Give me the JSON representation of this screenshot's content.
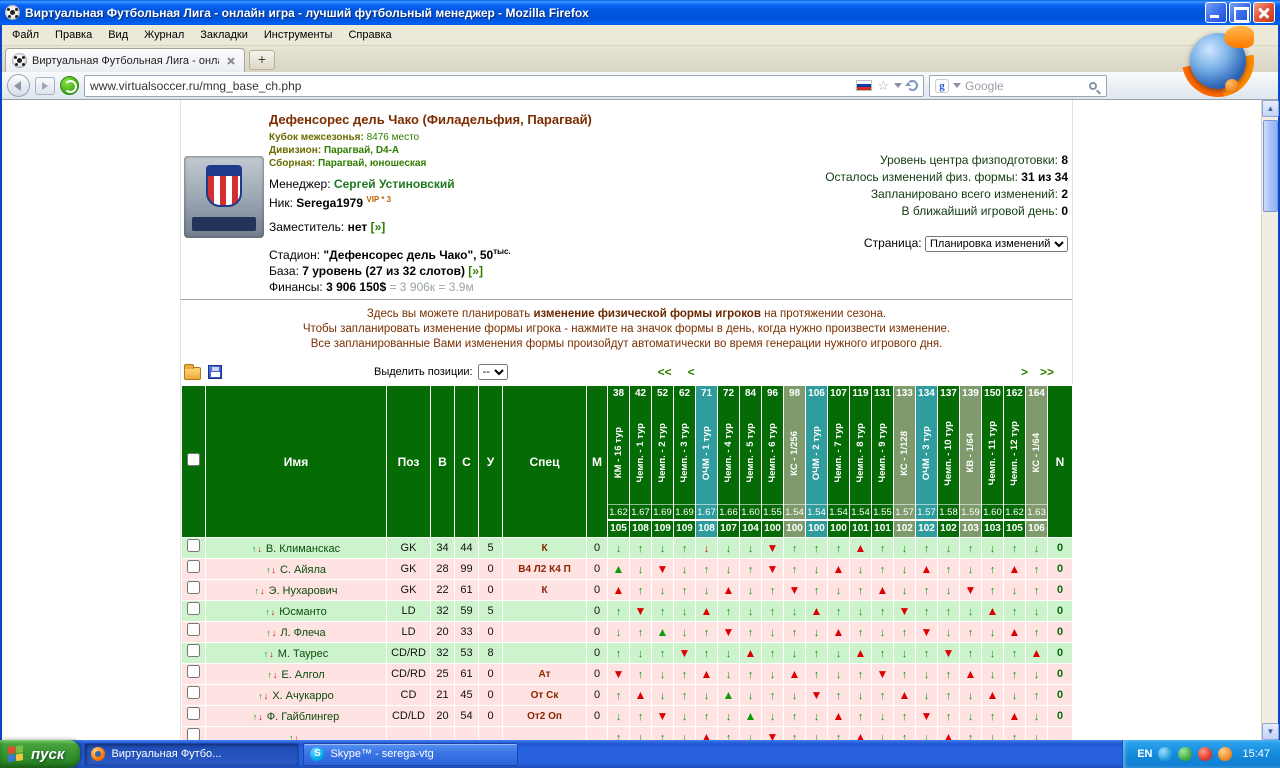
{
  "window": {
    "title": "Виртуальная Футбольная Лига - онлайн игра - лучший футбольный менеджер - Mozilla Firefox"
  },
  "menu": {
    "items": [
      "Файл",
      "Правка",
      "Вид",
      "Журнал",
      "Закладки",
      "Инструменты",
      "Справка"
    ]
  },
  "tabs": {
    "active": "Виртуальная Футбольная Лига - онлай...",
    "new_tab": "+"
  },
  "navbar": {
    "url": "www.virtualsoccer.ru/mng_base_ch.php",
    "search_placeholder": "Google"
  },
  "team": {
    "title": "Дефенсорес дель Чако (Филадельфия, Парагвай)",
    "cup_label": "Кубок межсезонья:",
    "cup_value": "8476 место",
    "division_label": "Дивизион:",
    "division_value": "Парагвай, D4-A",
    "national_label": "Сборная:",
    "national_value": "Парагвай, юношеская",
    "manager_label": "Менеджер:",
    "manager_value": "Сергей Устиновский",
    "nick_label": "Ник:",
    "nick_value": "Serega1979",
    "nick_vip": "VIP * 3",
    "deputy_label": "Заместитель:",
    "deputy_value": "нет",
    "deputy_link": "[»]",
    "stadium_label": "Стадион:",
    "stadium_value": "\"Дефенсорес дель Чако\", 50",
    "stadium_sup": "тыс.",
    "base_label": "База:",
    "base_value": "7 уровень (27 из 32 слотов)",
    "base_link": "[»]",
    "finances_label": "Финансы:",
    "finances_value": "3 906 150$",
    "finances_extra": "= 3 906к = 3.9м"
  },
  "info": {
    "lines": [
      {
        "label": "Уровень центра физподготовки:",
        "value": "8"
      },
      {
        "label": "Осталось изменений физ. формы:",
        "value": "31 из 34"
      },
      {
        "label": "Запланировано всего изменений:",
        "value": "2"
      },
      {
        "label": "В ближайший игровой день:",
        "value": "0"
      }
    ],
    "page_label": "Страница:",
    "page_value": "Планировка изменений"
  },
  "instructions": {
    "line1_pre": "Здесь вы можете планировать ",
    "line1_bold": "изменение физической формы игроков",
    "line1_post": " на протяжении сезона.",
    "line2": "Чтобы запланировать изменение формы игрока - нажмите на значок формы в день, когда нужно произвести изменение.",
    "line3": "Все запланированные Вами изменения формы произойдут автоматически во время генерации нужного игрового дня."
  },
  "toolbar": {
    "select_label": "Выделить позиции:",
    "select_value": "--",
    "pag_first": "<<",
    "pag_prev": "<",
    "pag_next": ">",
    "pag_last": ">>"
  },
  "table": {
    "header_left": [
      "Имя",
      "Поз",
      "В",
      "С",
      "У",
      "Спец",
      "М"
    ],
    "header_right": "N",
    "tours": [
      {
        "day": "38",
        "label": "КМ - 16 тур",
        "type": "km",
        "coef": "1.62",
        "wear": "105"
      },
      {
        "day": "42",
        "label": "Чемп. - 1 тур",
        "type": "ch",
        "coef": "1.67",
        "wear": "108"
      },
      {
        "day": "52",
        "label": "Чемп. - 2 тур",
        "type": "ch",
        "coef": "1.69",
        "wear": "109"
      },
      {
        "day": "62",
        "label": "Чемп. - 3 тур",
        "type": "ch",
        "coef": "1.69",
        "wear": "109"
      },
      {
        "day": "71",
        "label": "ОЧМ - 1 тур",
        "type": "ochm",
        "coef": "1.67",
        "wear": "108"
      },
      {
        "day": "72",
        "label": "Чемп. - 4 тур",
        "type": "ch",
        "coef": "1.66",
        "wear": "107"
      },
      {
        "day": "84",
        "label": "Чемп. - 5 тур",
        "type": "ch",
        "coef": "1.60",
        "wear": "104"
      },
      {
        "day": "96",
        "label": "Чемп. - 6 тур",
        "type": "ch",
        "coef": "1.55",
        "wear": "100"
      },
      {
        "day": "98",
        "label": "КС - 1/256",
        "type": "ks",
        "coef": "1.54",
        "wear": "100"
      },
      {
        "day": "106",
        "label": "ОЧМ - 2 тур",
        "type": "ochm",
        "coef": "1.54",
        "wear": "100"
      },
      {
        "day": "107",
        "label": "Чемп. - 7 тур",
        "type": "ch",
        "coef": "1.54",
        "wear": "100"
      },
      {
        "day": "119",
        "label": "Чемп. - 8 тур",
        "type": "ch",
        "coef": "1.54",
        "wear": "101"
      },
      {
        "day": "131",
        "label": "Чемп. - 9 тур",
        "type": "ch",
        "coef": "1.55",
        "wear": "101"
      },
      {
        "day": "133",
        "label": "КС - 1/128",
        "type": "ks",
        "coef": "1.57",
        "wear": "102"
      },
      {
        "day": "134",
        "label": "ОЧМ - 3 тур",
        "type": "ochm",
        "coef": "1.57",
        "wear": "102"
      },
      {
        "day": "137",
        "label": "Чемп. - 10 тур",
        "type": "ch",
        "coef": "1.58",
        "wear": "102"
      },
      {
        "day": "139",
        "label": "КВ - 1/64",
        "type": "kv",
        "coef": "1.59",
        "wear": "103"
      },
      {
        "day": "150",
        "label": "Чемп. - 11 тур",
        "type": "ch",
        "coef": "1.60",
        "wear": "103"
      },
      {
        "day": "162",
        "label": "Чемп. - 12 тур",
        "type": "ch",
        "coef": "1.62",
        "wear": "105"
      },
      {
        "day": "164",
        "label": "КС - 1/64",
        "type": "ks",
        "coef": "1.63",
        "wear": "106"
      }
    ],
    "players": [
      {
        "name": "В. Климанскас",
        "pos": "GK",
        "age": "34",
        "strength": "44",
        "fatigue": "5",
        "spec": "К",
        "morale": "0",
        "n": "0",
        "row": "g",
        "arrows": [
          "gd",
          "gu",
          "gd",
          "gu",
          "rd",
          "gd",
          "gd",
          "RD",
          "gu",
          "gu",
          "gu",
          "RU",
          "gu",
          "gd",
          "gu",
          "gd",
          "gu",
          "gd",
          "gu",
          "gd"
        ]
      },
      {
        "name": "С. Айяла",
        "pos": "GK",
        "age": "28",
        "strength": "99",
        "fatigue": "0",
        "spec": "В4 Л2 К4 П",
        "morale": "0",
        "n": "0",
        "row": "p",
        "arrows": [
          "GU",
          "gd",
          "RD",
          "gd",
          "gu",
          "gd",
          "gu",
          "RD",
          "gu",
          "gd",
          "RU",
          "gd",
          "gu",
          "gd",
          "RU",
          "gu",
          "gd",
          "gu",
          "RU",
          "gu"
        ]
      },
      {
        "name": "Э. Нухарович",
        "pos": "GK",
        "age": "22",
        "strength": "61",
        "fatigue": "0",
        "spec": "К",
        "morale": "0",
        "n": "0",
        "row": "p",
        "arrows": [
          "RU",
          "gu",
          "gd",
          "gu",
          "gd",
          "RU",
          "gd",
          "gu",
          "RD",
          "gu",
          "gd",
          "gu",
          "RU",
          "gd",
          "gu",
          "gd",
          "RD",
          "gu",
          "gd",
          "gu"
        ]
      },
      {
        "name": "Юсманто",
        "pos": "LD",
        "age": "32",
        "strength": "59",
        "fatigue": "5",
        "spec": "",
        "morale": "0",
        "n": "0",
        "row": "g",
        "arrows": [
          "gu",
          "RD",
          "gu",
          "gd",
          "RU",
          "gu",
          "gd",
          "gu",
          "gd",
          "RU",
          "gu",
          "gd",
          "gu",
          "RD",
          "gu",
          "gu",
          "gd",
          "RU",
          "gu",
          "gd"
        ]
      },
      {
        "name": "Л. Флеча",
        "pos": "LD",
        "age": "20",
        "strength": "33",
        "fatigue": "0",
        "spec": "",
        "morale": "0",
        "n": "0",
        "row": "p",
        "arrows": [
          "gd",
          "gu",
          "GU",
          "gd",
          "gu",
          "RD",
          "gu",
          "gd",
          "gu",
          "gd",
          "RU",
          "gu",
          "gd",
          "gu",
          "RD",
          "gd",
          "gu",
          "gd",
          "RU",
          "gu"
        ]
      },
      {
        "name": "М. Таурес",
        "pos": "CD/RD",
        "age": "32",
        "strength": "53",
        "fatigue": "8",
        "spec": "",
        "morale": "0",
        "n": "0",
        "row": "g",
        "arrows": [
          "gu",
          "gd",
          "gu",
          "RD",
          "gu",
          "gd",
          "RU",
          "gu",
          "gd",
          "gu",
          "gd",
          "RU",
          "gu",
          "gd",
          "gu",
          "RD",
          "gu",
          "gd",
          "gu",
          "RU"
        ]
      },
      {
        "name": "Е. Алгол",
        "pos": "CD/RD",
        "age": "25",
        "strength": "61",
        "fatigue": "0",
        "spec": "Ат",
        "morale": "0",
        "n": "0",
        "row": "p",
        "arrows": [
          "RD",
          "gu",
          "gd",
          "gu",
          "RU",
          "gd",
          "gu",
          "gd",
          "RU",
          "gu",
          "gd",
          "gu",
          "RD",
          "gu",
          "gd",
          "gu",
          "RU",
          "gd",
          "gu",
          "gd"
        ]
      },
      {
        "name": "Х. Ачукарро",
        "pos": "CD",
        "age": "21",
        "strength": "45",
        "fatigue": "0",
        "spec": "От Ск",
        "morale": "0",
        "n": "0",
        "row": "p",
        "arrows": [
          "gu",
          "RU",
          "gd",
          "gu",
          "gd",
          "GU",
          "gd",
          "gu",
          "gd",
          "RD",
          "gu",
          "gd",
          "gu",
          "RU",
          "gd",
          "gu",
          "gd",
          "RU",
          "gd",
          "gu"
        ]
      },
      {
        "name": "Ф. Гайблингер",
        "pos": "CD/LD",
        "age": "20",
        "strength": "54",
        "fatigue": "0",
        "spec": "От2 Оп",
        "morale": "0",
        "n": "0",
        "row": "p",
        "arrows": [
          "gd",
          "gu",
          "RD",
          "gd",
          "gu",
          "gd",
          "GU",
          "gd",
          "gu",
          "gd",
          "RU",
          "gu",
          "gd",
          "gu",
          "RD",
          "gu",
          "gd",
          "gu",
          "RU",
          "gd"
        ]
      },
      {
        "name": "",
        "pos": "",
        "age": "",
        "strength": "",
        "fatigue": "",
        "spec": "",
        "morale": "",
        "n": "",
        "row": "p",
        "arrows": [
          "gu",
          "gd",
          "gu",
          "gd",
          "RU",
          "gu",
          "gd",
          "RD",
          "gu",
          "gd",
          "gu",
          "RU",
          "gd",
          "gu",
          "gd",
          "RU",
          "gu",
          "gd",
          "gu",
          "gd"
        ]
      }
    ]
  },
  "taskbar": {
    "start": "пуск",
    "buttons": [
      {
        "label": "Виртуальная Футбо..."
      },
      {
        "label": "Skype™ - serega-vtg"
      }
    ],
    "lang": "EN",
    "time": "15:47"
  }
}
